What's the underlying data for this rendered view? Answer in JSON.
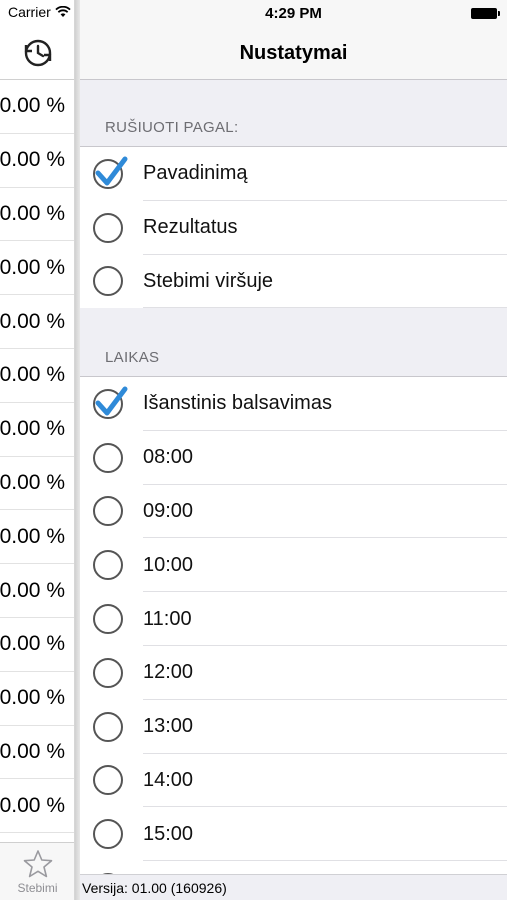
{
  "left_panel": {
    "carrier": "Carrier",
    "history_icon": "history-clock-icon",
    "percent_rows": [
      "0.00 %",
      "0.00 %",
      "0.00 %",
      "0.00 %",
      "0.00 %",
      "0.00 %",
      "0.00 %",
      "0.00 %",
      "0.00 %",
      "0.00 %",
      "0.00 %",
      "0.00 %",
      "0.00 %",
      "0.00 %"
    ],
    "tab": {
      "icon": "star-icon",
      "label": "Stebimi"
    }
  },
  "status_bar": {
    "time": "4:29 PM"
  },
  "nav": {
    "title": "Nustatymai"
  },
  "sections": [
    {
      "header": "RUŠIUOTI PAGAL:",
      "options": [
        {
          "label": "Pavadinimą",
          "selected": true
        },
        {
          "label": "Rezultatus",
          "selected": false
        },
        {
          "label": "Stebimi viršuje",
          "selected": false
        }
      ]
    },
    {
      "header": "LAIKAS",
      "options": [
        {
          "label": "Išanstinis balsavimas",
          "selected": true
        },
        {
          "label": "08:00",
          "selected": false
        },
        {
          "label": "09:00",
          "selected": false
        },
        {
          "label": "10:00",
          "selected": false
        },
        {
          "label": "11:00",
          "selected": false
        },
        {
          "label": "12:00",
          "selected": false
        },
        {
          "label": "13:00",
          "selected": false
        },
        {
          "label": "14:00",
          "selected": false
        },
        {
          "label": "15:00",
          "selected": false
        },
        {
          "label": "",
          "selected": false
        }
      ]
    }
  ],
  "footer": {
    "version": "Versija: 01.00 (160926)"
  },
  "colors": {
    "accent": "#2f8ad8",
    "background": "#efeff4"
  }
}
